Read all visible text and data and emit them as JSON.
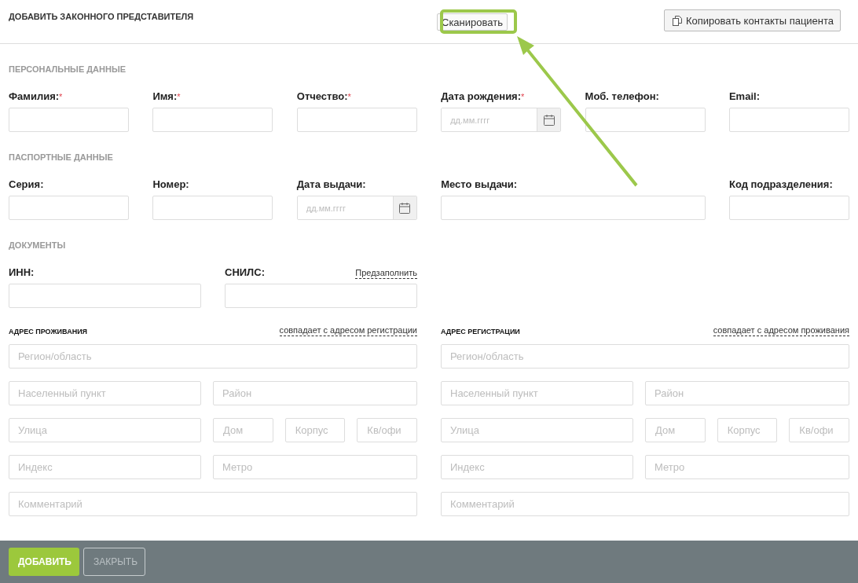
{
  "header": {
    "title": "ДОБАВИТЬ ЗАКОННОГО ПРЕДСТАВИТЕЛЯ",
    "scan_button": "Сканировать",
    "copy_button": "Копировать контакты пациента"
  },
  "sections": [
    {
      "title": "ПЕРСОНАЛЬНЫЕ ДАННЫЕ",
      "kind": "grid",
      "fields": [
        {
          "label": "Фамилия:",
          "mark": "*",
          "kind": "text"
        },
        {
          "label": "Имя:",
          "mark": "*",
          "kind": "text"
        },
        {
          "label": "Отчество:",
          "mark": "*",
          "kind": "text"
        },
        {
          "label": "Дата рождения:",
          "mark": "*",
          "kind": "date",
          "placeholder": "дд.мм.гггг"
        },
        {
          "label": "Моб. телефон:",
          "kind": "text"
        },
        {
          "label": "Email:",
          "kind": "text"
        }
      ]
    },
    {
      "title": "ПАСПОРТНЫЕ ДАННЫЕ",
      "kind": "grid",
      "fields": [
        {
          "label": "Серия:",
          "kind": "text"
        },
        {
          "label": "Номер:",
          "kind": "text"
        },
        {
          "label": "Дата выдачи:",
          "kind": "date",
          "placeholder": "дд.мм.гггг"
        },
        {
          "label": "Место выдачи:",
          "kind": "wide"
        },
        {
          "label": "Код подразделения:",
          "kind": "text"
        }
      ]
    },
    {
      "title": "ДОКУМЕНТЫ",
      "kind": "docs",
      "fields": [
        {
          "label": "ИНН:",
          "kind": "text"
        },
        {
          "label": "СНИЛС:",
          "kind": "text",
          "link": "Предзаполнить"
        }
      ]
    }
  ],
  "addresses": [
    {
      "title": "АДРЕС ПРОЖИВАНИЯ",
      "link": "совпадает с адресом регистрации",
      "rows": [
        {
          "kind": "full",
          "fields": [
            {
              "placeholder": "Регион/область"
            }
          ]
        },
        {
          "kind": "pair",
          "fields": [
            {
              "placeholder": "Населенный пункт"
            },
            {
              "placeholder": "Район"
            }
          ]
        },
        {
          "kind": "street",
          "fields": [
            {
              "placeholder": "Улица"
            },
            {
              "placeholder": "Дом"
            },
            {
              "placeholder": "Корпус"
            },
            {
              "placeholder": "Кв/офи"
            }
          ]
        },
        {
          "kind": "pair",
          "fields": [
            {
              "placeholder": "Индекс"
            },
            {
              "placeholder": "Метро"
            }
          ]
        },
        {
          "kind": "full",
          "fields": [
            {
              "placeholder": "Комментарий"
            }
          ]
        }
      ]
    },
    {
      "title": "АДРЕС РЕГИСТРАЦИИ",
      "link": "совпадает с адресом проживания",
      "rows": [
        {
          "kind": "full",
          "fields": [
            {
              "placeholder": "Регион/область"
            }
          ]
        },
        {
          "kind": "pair",
          "fields": [
            {
              "placeholder": "Населенный пункт"
            },
            {
              "placeholder": "Район"
            }
          ]
        },
        {
          "kind": "street",
          "fields": [
            {
              "placeholder": "Улица"
            },
            {
              "placeholder": "Дом"
            },
            {
              "placeholder": "Корпус"
            },
            {
              "placeholder": "Кв/офи"
            }
          ]
        },
        {
          "kind": "pair",
          "fields": [
            {
              "placeholder": "Индекс"
            },
            {
              "placeholder": "Метро"
            }
          ]
        },
        {
          "kind": "full",
          "fields": [
            {
              "placeholder": "Комментарий"
            }
          ]
        }
      ]
    }
  ],
  "footer": {
    "buttons": [
      {
        "label": "ДОБАВИТЬ",
        "kind": "primary"
      },
      {
        "label": "ЗАКРЫТЬ",
        "kind": "secondary"
      }
    ]
  }
}
